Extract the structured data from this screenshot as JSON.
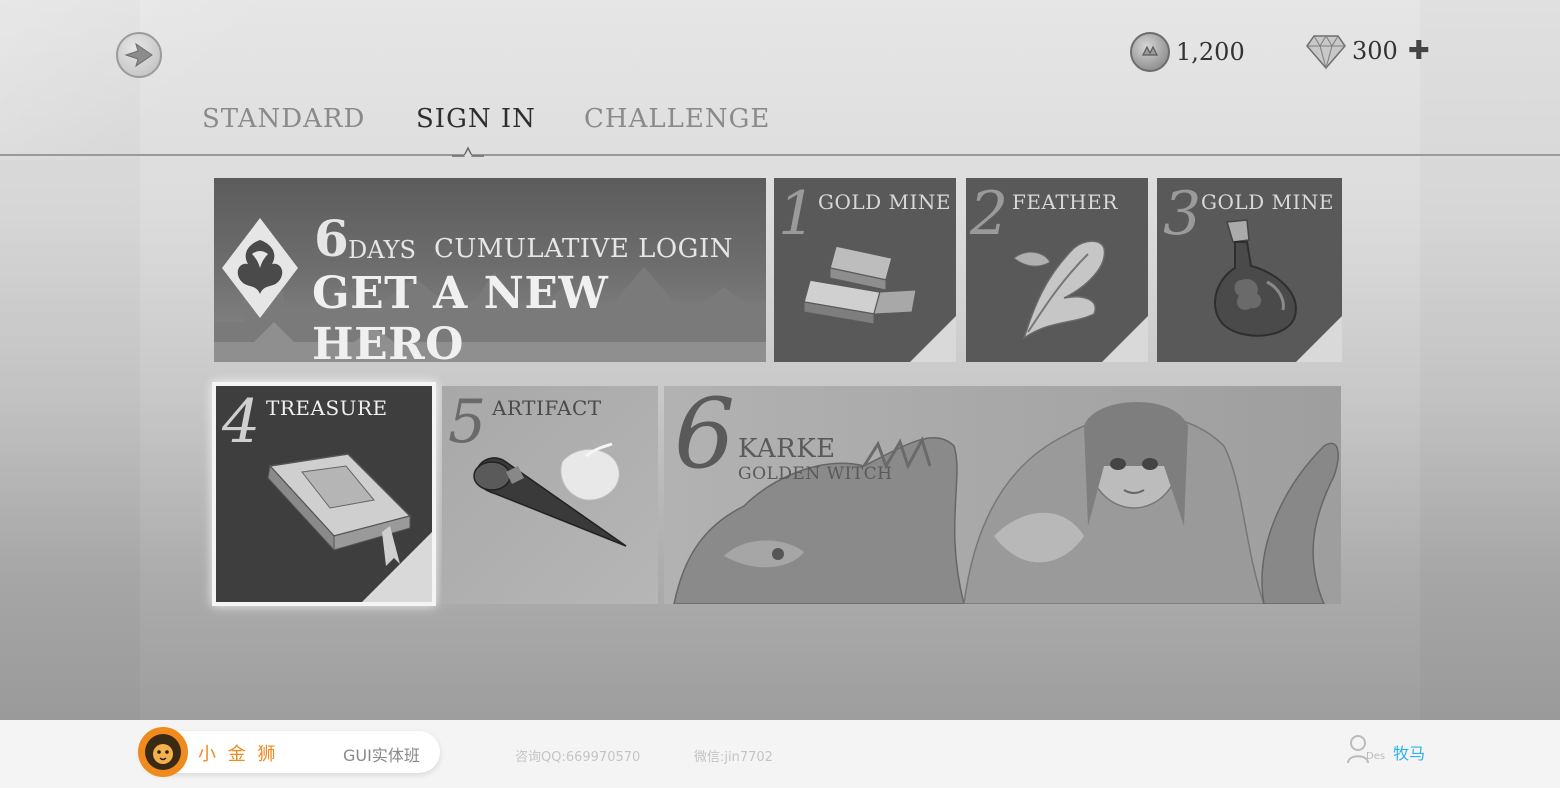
{
  "header": {
    "coins": "1,200",
    "gems": "300"
  },
  "tabs": [
    {
      "label": "STANDARD",
      "active": false
    },
    {
      "label": "SIGN IN",
      "active": true
    },
    {
      "label": "CHALLENGE",
      "active": false
    }
  ],
  "banner": {
    "days_number": "6",
    "days_label": "DAYS",
    "subtitle": "CUMULATIVE LOGIN",
    "title": "GET A NEW HERO"
  },
  "rewards": [
    {
      "day": "1",
      "name": "GOLD MINE"
    },
    {
      "day": "2",
      "name": "FEATHER"
    },
    {
      "day": "3",
      "name": "GOLD MINE"
    },
    {
      "day": "4",
      "name": "TREASURE"
    },
    {
      "day": "5",
      "name": "ARTIFACT"
    },
    {
      "day": "6",
      "name": "KARKE",
      "subtitle": "GOLDEN WITCH"
    }
  ],
  "footer": {
    "brand_name": "小 金 狮",
    "brand_class": "GUI实体班",
    "qq": "咨询QQ:669970570",
    "wechat": "微信:jin7702",
    "author_tag": "Des",
    "author_name": "牧马"
  },
  "colors": {
    "brand_orange": "#f08a1c",
    "author_blue": "#2bb3e6",
    "active_tab": "#2e2e2e",
    "inactive_tab": "#8a8a8a"
  }
}
